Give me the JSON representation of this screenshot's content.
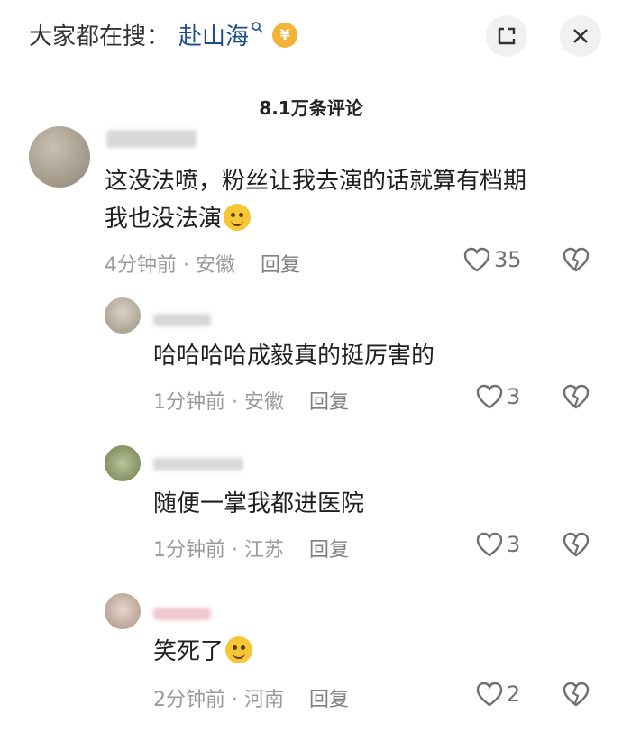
{
  "header": {
    "search_prefix": "大家都在搜：",
    "search_keyword": "赴山海",
    "search_icon": "search-icon",
    "coin_symbol": "¥",
    "expand_icon": "expand-icon",
    "close_icon": "close-icon"
  },
  "comment_count": "8.1万条评论",
  "comments": [
    {
      "text_line1": "这没法喷，粉丝让我去演的话就算有档期",
      "text_line2": "我也没法演",
      "time": "4分钟前",
      "location": "安徽",
      "reply_label": "回复",
      "likes": "35"
    },
    {
      "text": "哈哈哈哈成毅真的挺厉害的",
      "time": "1分钟前",
      "location": "安徽",
      "reply_label": "回复",
      "likes": "3"
    },
    {
      "text": "随便一掌我都进医院",
      "time": "1分钟前",
      "location": "江苏",
      "reply_label": "回复",
      "likes": "3"
    },
    {
      "text": "笑死了",
      "time": "2分钟前",
      "location": "河南",
      "reply_label": "回复",
      "likes": "2"
    }
  ],
  "meta_separator": " · ",
  "colors": {
    "keyword": "#1e4f8c",
    "coin": "#f5b238",
    "meta": "#9a9a9a"
  }
}
